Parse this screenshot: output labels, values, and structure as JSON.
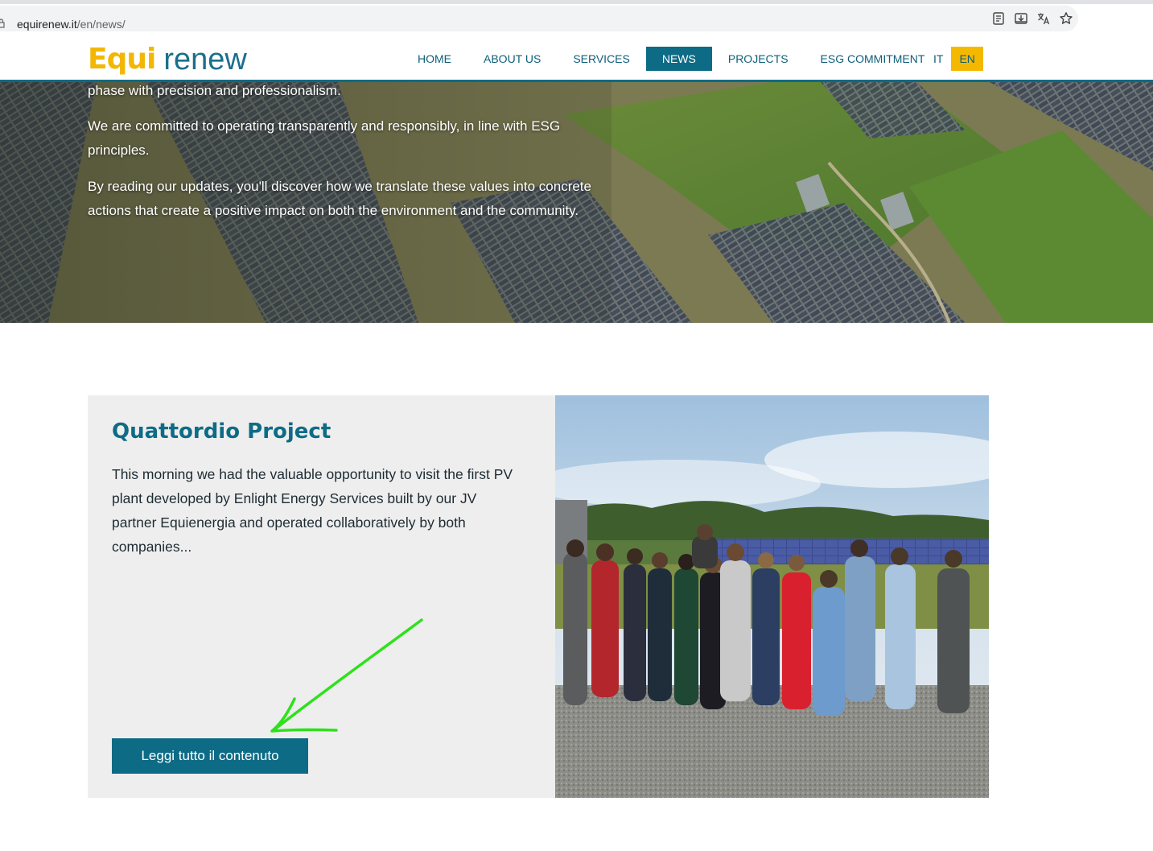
{
  "browser": {
    "url_domain": "equirenew.it",
    "url_path": "/en/news/",
    "icons": [
      "lock-icon",
      "reader-mode-icon",
      "install-icon",
      "translate-icon",
      "bookmark-star-icon"
    ]
  },
  "header": {
    "logo_left": "Equi",
    "logo_right": "renew",
    "nav": [
      {
        "label": "HOME",
        "active": false
      },
      {
        "label": "ABOUT US",
        "active": false
      },
      {
        "label": "SERVICES",
        "active": false
      },
      {
        "label": "NEWS",
        "active": true
      },
      {
        "label": "PROJECTS",
        "active": false
      },
      {
        "label": "ESG COMMITMENT",
        "active": false
      }
    ],
    "languages": [
      {
        "label": "IT",
        "active": false
      },
      {
        "label": "EN",
        "active": true
      }
    ]
  },
  "hero": {
    "paragraphs": [
      "phase with precision and professionalism.",
      "We are committed to operating transparently and responsibly, in line with ESG principles.",
      "By reading our updates, you'll discover how we translate these values into concrete actions that create a positive impact on both the environment and the community."
    ]
  },
  "news_card": {
    "title": "Quattordio Project",
    "excerpt": "This morning we had the valuable opportunity to visit the first PV plant developed by Enlight Energy Services built by our JV partner Equienergia and operated collaboratively by both companies...",
    "button_label": "Leggi tutto il contenuto"
  },
  "colors": {
    "brand_teal": "#0e6b86",
    "brand_yellow": "#f5b800",
    "annotation_arrow": "#2ee11b"
  }
}
